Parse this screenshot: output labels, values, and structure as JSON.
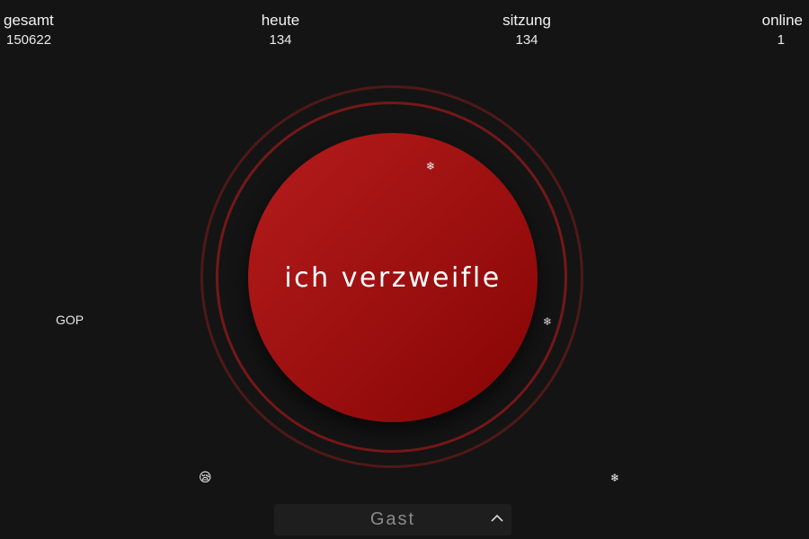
{
  "stats": {
    "gesamt": {
      "label": "gesamt",
      "value": "150622"
    },
    "heute": {
      "label": "heute",
      "value": "134"
    },
    "sitzung": {
      "label": "sitzung",
      "value": "134"
    },
    "online": {
      "label": "online",
      "value": "1"
    }
  },
  "main_button": {
    "label": "ich verzweifle",
    "color": "#a31313"
  },
  "floaters": {
    "gop": "GOP",
    "emoji": "😪",
    "snowflake": "❄"
  },
  "user_select": {
    "value": "Gast",
    "icon": "chevron-up-icon"
  }
}
